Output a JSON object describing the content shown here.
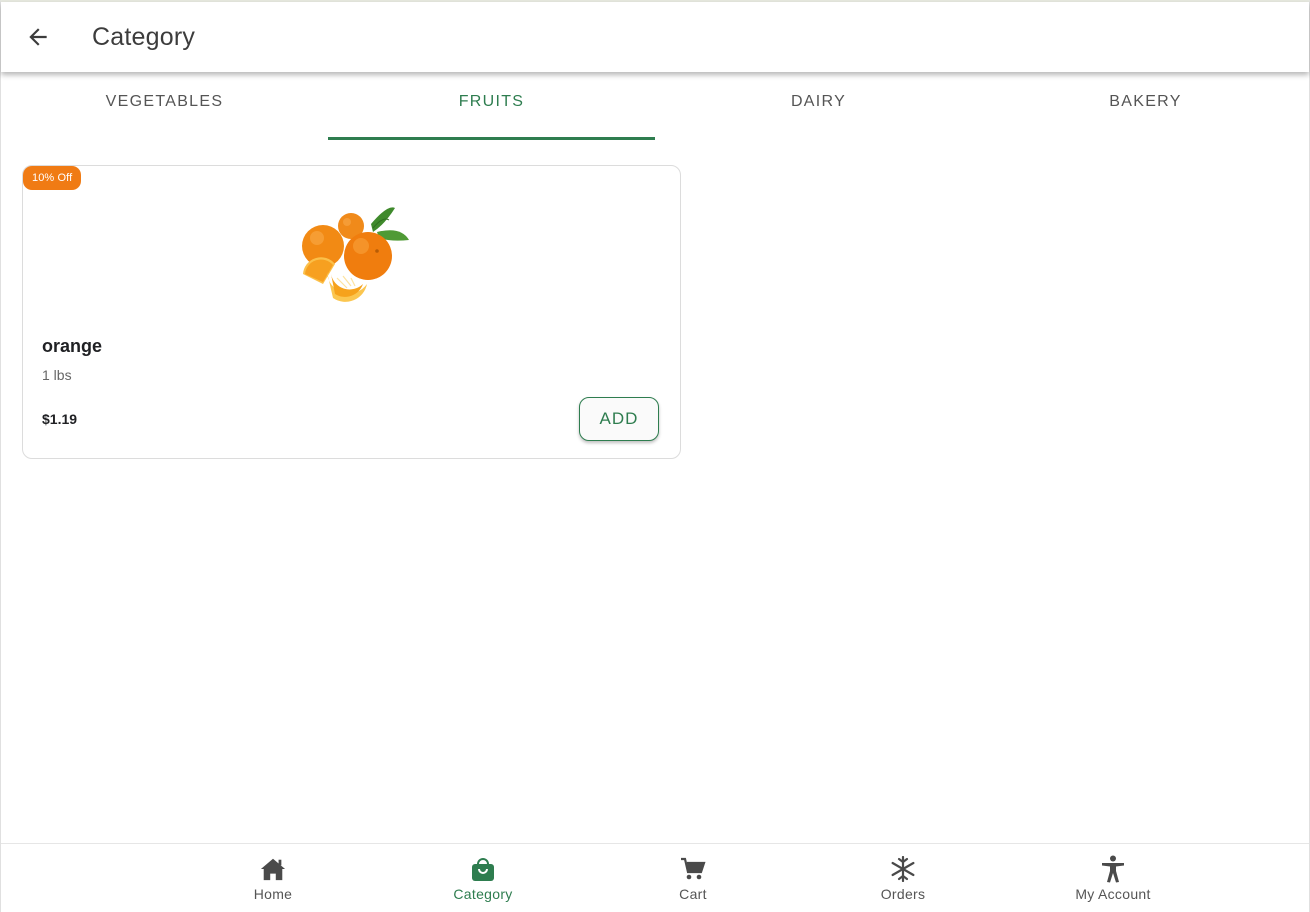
{
  "appbar": {
    "title": "Category",
    "back_icon": "arrow-left-icon"
  },
  "tabs": [
    {
      "label": "VEGETABLES",
      "active": false
    },
    {
      "label": "FRUITS",
      "active": true
    },
    {
      "label": "DAIRY",
      "active": false
    },
    {
      "label": "BAKERY",
      "active": false
    }
  ],
  "products": [
    {
      "badge": "10% Off",
      "name": "orange",
      "unit": "1 lbs",
      "price": "$1.19",
      "add_label": "ADD",
      "image": "orange-fruit-image"
    }
  ],
  "bottom_nav": [
    {
      "label": "Home",
      "icon": "home-icon",
      "active": false
    },
    {
      "label": "Category",
      "icon": "shopping-bag-icon",
      "active": true
    },
    {
      "label": "Cart",
      "icon": "cart-icon",
      "active": false
    },
    {
      "label": "Orders",
      "icon": "snowflake-icon",
      "active": false
    },
    {
      "label": "My Account",
      "icon": "accessibility-icon",
      "active": false
    }
  ],
  "colors": {
    "accent": "#2e7d4f",
    "badge": "#f07b14",
    "text_muted": "#555555"
  }
}
